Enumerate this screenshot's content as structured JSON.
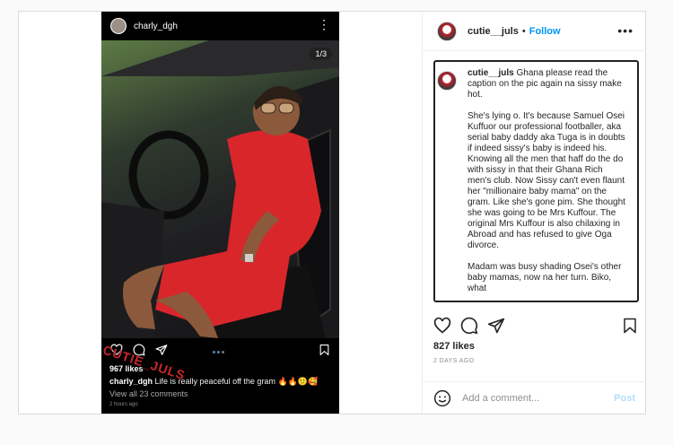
{
  "post": {
    "screenshot": {
      "username": "charly_dgh",
      "counter": "1/3",
      "likes": "967 likes",
      "caption_user": "charly_dgh",
      "caption_text": "Life is really peaceful off the gram 🔥🔥🙂🥰",
      "view_comments": "View all 23 comments",
      "time": "2 hours ago",
      "watermark": "CUTIE_JULS"
    },
    "author": {
      "username": "cutie__juls",
      "separator": "•",
      "follow_label": "Follow"
    },
    "caption": {
      "username": "cutie__juls",
      "intro": "Ghana please read the caption on the pic again na sissy make hot.",
      "para1": "She's lying o. It's because Samuel Osei Kuffuor our professional footballer, aka serial baby daddy aka Tuga is in doubts if indeed sissy's baby is indeed his. Knowing all the men that haff do the do with sissy in that their Ghana Rich men's club. Now Sissy can't even flaunt her \"millionaire baby mama\" on the gram. Like she's gone pim. She thought she was going to be Mrs Kuffour. The original Mrs Kuffour is also chilaxing in Abroad and has refused to give Oga divorce.",
      "para2": "Madam was busy shading Osei's other baby mamas, now na her turn. Biko, what"
    },
    "likes": "827 likes",
    "age": "2 DAYS AGO",
    "add_comment_placeholder": "Add a comment...",
    "post_label": "Post"
  },
  "icons": [
    "heart-icon",
    "comment-icon",
    "share-icon",
    "bookmark-icon",
    "emoji-icon",
    "more-icon"
  ],
  "colors": {
    "accent": "#0095f6",
    "post_disabled": "#b2dffc",
    "watermark": "#c8282b"
  }
}
